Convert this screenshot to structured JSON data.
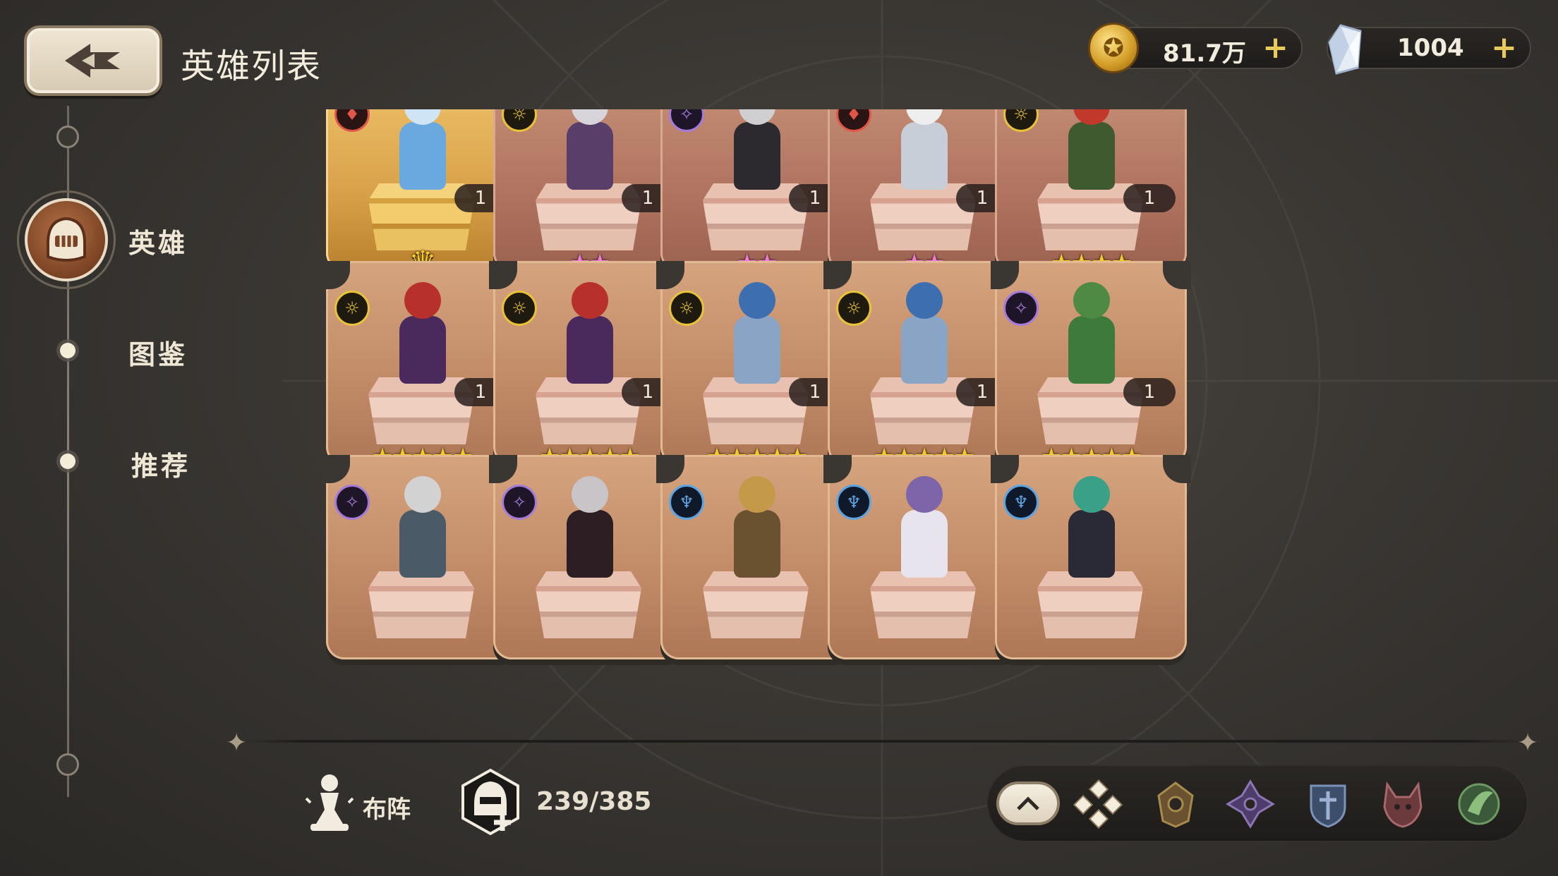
{
  "header": {
    "title": "英雄列表",
    "gold": {
      "amount": "81.7万",
      "plus": "+"
    },
    "gems": {
      "amount": "1004",
      "plus": "+"
    }
  },
  "sidebar": {
    "items": [
      {
        "label": "英雄",
        "active": true
      },
      {
        "label": "图鉴",
        "active": false
      },
      {
        "label": "推荐",
        "active": false
      }
    ]
  },
  "heroes": [
    {
      "level": "1",
      "stars": 2,
      "star_color": "gold-crown",
      "faction": "red",
      "card": "gold"
    },
    {
      "level": "1",
      "stars": 2,
      "star_color": "pink",
      "faction": "yellow",
      "card": "normal"
    },
    {
      "level": "1",
      "stars": 2,
      "star_color": "pink",
      "faction": "purple",
      "card": "normal"
    },
    {
      "level": "1",
      "stars": 2,
      "star_color": "pink",
      "faction": "red",
      "card": "normal"
    },
    {
      "level": "1",
      "stars": 4,
      "star_color": "gold",
      "faction": "yellow",
      "card": "normal"
    },
    {
      "level": "1",
      "stars": 5,
      "star_color": "gold",
      "faction": "yellow",
      "card": "orange"
    },
    {
      "level": "1",
      "stars": 5,
      "star_color": "gold",
      "faction": "yellow",
      "card": "orange"
    },
    {
      "level": "1",
      "stars": 5,
      "star_color": "gold",
      "faction": "yellow",
      "card": "orange"
    },
    {
      "level": "1",
      "stars": 5,
      "star_color": "gold",
      "faction": "yellow",
      "card": "orange"
    },
    {
      "level": "1",
      "stars": 5,
      "star_color": "gold",
      "faction": "purple",
      "card": "orange"
    },
    {
      "level": "",
      "stars": 0,
      "star_color": "gold",
      "faction": "purple",
      "card": "orange"
    },
    {
      "level": "",
      "stars": 0,
      "star_color": "gold",
      "faction": "purple",
      "card": "orange"
    },
    {
      "level": "",
      "stars": 0,
      "star_color": "gold",
      "faction": "blue",
      "card": "orange"
    },
    {
      "level": "",
      "stars": 0,
      "star_color": "gold",
      "faction": "blue",
      "card": "orange"
    },
    {
      "level": "",
      "stars": 0,
      "star_color": "gold",
      "faction": "blue",
      "card": "orange"
    }
  ],
  "bottom": {
    "formation_label": "布阵",
    "hero_count": "239/385",
    "filters": [
      "all-factions-icon",
      "nature-faction-icon",
      "arcane-faction-icon",
      "order-faction-icon",
      "beast-faction-icon",
      "wild-faction-icon"
    ],
    "expand_label": "^"
  },
  "colors": {
    "accent_gold": "#e8c95c",
    "card_brown": "#b07460",
    "star_gold": "#f4c92c",
    "star_pink": "#f07ad6"
  }
}
